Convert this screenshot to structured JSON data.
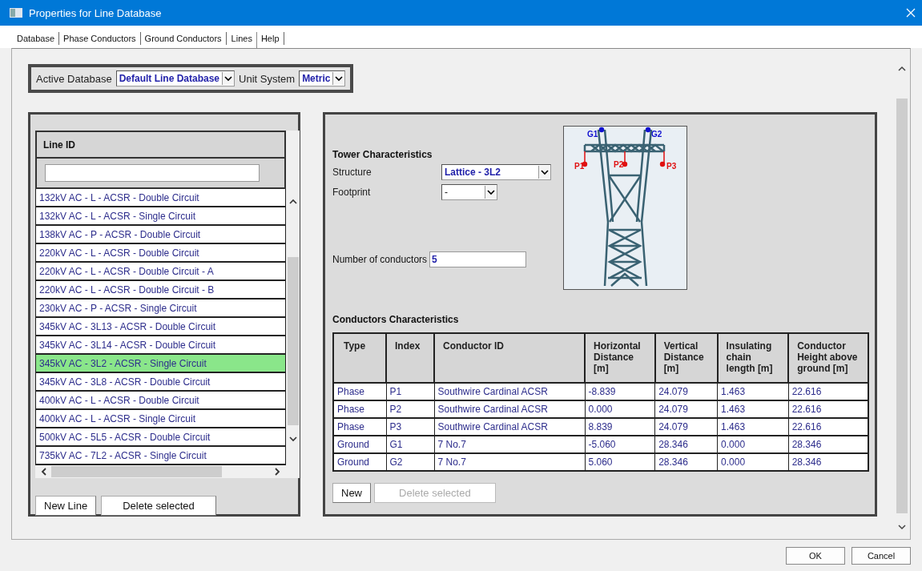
{
  "window": {
    "title": "Properties for Line Database"
  },
  "tabs": [
    {
      "label": "Database",
      "selected": false
    },
    {
      "label": "Phase Conductors",
      "selected": false
    },
    {
      "label": "Ground Conductors",
      "selected": false
    },
    {
      "label": "Lines",
      "selected": true
    },
    {
      "label": "Help",
      "selected": false
    }
  ],
  "settings": {
    "active_database_label": "Active Database",
    "active_database": "Default Line Database",
    "unit_system_label": "Unit System",
    "unit_system": "Metric"
  },
  "line_list": {
    "column": "Line ID",
    "rows": [
      {
        "label": "132kV AC - L - ACSR - Double Circuit",
        "selected": false
      },
      {
        "label": "132kV AC - L - ACSR - Single Circuit",
        "selected": false
      },
      {
        "label": "138kV AC - P - ACSR - Double Circuit",
        "selected": false
      },
      {
        "label": "220kV AC - L - ACSR - Double Circuit",
        "selected": false
      },
      {
        "label": "220kV AC - L - ACSR - Double Circuit - A",
        "selected": false
      },
      {
        "label": "220kV AC - L - ACSR - Double Circuit - B",
        "selected": false
      },
      {
        "label": "230kV AC - P - ACSR - Single Circuit",
        "selected": false
      },
      {
        "label": "345kV AC - 3L13 - ACSR - Double Circuit",
        "selected": false
      },
      {
        "label": "345kV AC - 3L14 - ACSR - Double Circuit",
        "selected": false
      },
      {
        "label": "345kV AC - 3L2 - ACSR - Single Circuit",
        "selected": true
      },
      {
        "label": "345kV AC - 3L8 - ACSR - Double Circuit",
        "selected": false
      },
      {
        "label": "400kV AC - L - ACSR - Double Circuit",
        "selected": false
      },
      {
        "label": "400kV AC - L - ACSR - Single Circuit",
        "selected": false
      },
      {
        "label": "500kV AC - 5L5 - ACSR - Double Circuit",
        "selected": false
      },
      {
        "label": "735kV AC - 7L2 - ACSR - Single Circuit",
        "selected": false
      }
    ],
    "buttons": [
      {
        "label": "New Line",
        "disabled": false
      },
      {
        "label": "Delete selected",
        "disabled": false
      }
    ]
  },
  "tower": {
    "title": "Tower Characteristics",
    "structure_label": "Structure",
    "structure": "Lattice - 3L2",
    "footprint_label": "Footprint",
    "footprint": "-",
    "conductors_label": "Number of conductors",
    "conductors": "5",
    "points": [
      {
        "label": "G1",
        "kind": "ground"
      },
      {
        "label": "G2",
        "kind": "ground"
      },
      {
        "label": "P1",
        "kind": "phase"
      },
      {
        "label": "P2",
        "kind": "phase"
      },
      {
        "label": "P3",
        "kind": "phase"
      }
    ]
  },
  "conductors": {
    "title": "Conductors Characteristics",
    "columns": [
      "Type",
      "Index",
      "Conductor ID",
      "Horizontal Distance [m]",
      "Vertical Distance [m]",
      "Insulating chain length [m]",
      "Conductor Height above ground [m]"
    ],
    "rows": [
      [
        "Phase",
        "P1",
        "Southwire Cardinal ACSR",
        "-8.839",
        "24.079",
        "1.463",
        "22.616"
      ],
      [
        "Phase",
        "P2",
        "Southwire Cardinal ACSR",
        "0.000",
        "24.079",
        "1.463",
        "22.616"
      ],
      [
        "Phase",
        "P3",
        "Southwire Cardinal ACSR",
        "8.839",
        "24.079",
        "1.463",
        "22.616"
      ],
      [
        "Ground",
        "G1",
        "7 No.7",
        "-5.060",
        "28.346",
        "0.000",
        "28.346"
      ],
      [
        "Ground",
        "G2",
        "7 No.7",
        "5.060",
        "28.346",
        "0.000",
        "28.346"
      ]
    ],
    "buttons": [
      {
        "label": "New",
        "disabled": false
      },
      {
        "label": "Delete selected",
        "disabled": true
      }
    ]
  },
  "dialog_buttons": [
    {
      "label": "OK",
      "disabled": false
    },
    {
      "label": "Cancel",
      "disabled": false
    }
  ]
}
